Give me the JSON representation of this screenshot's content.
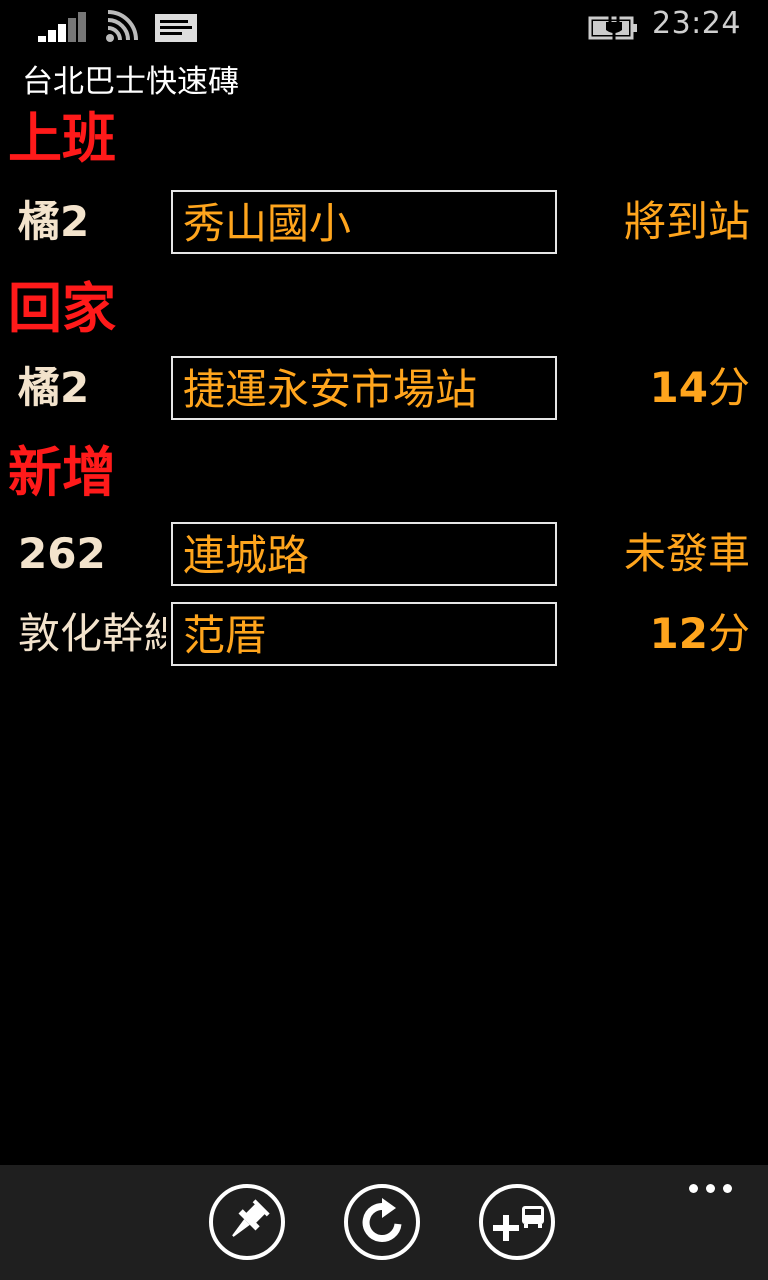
{
  "status_bar": {
    "time": "23:24",
    "icons": [
      "signal-icon",
      "wifi-icon",
      "message-icon",
      "battery-charging-icon"
    ]
  },
  "app": {
    "title": "台北巴士快速磚"
  },
  "sections": [
    {
      "heading": "上班",
      "rows": [
        {
          "route": "橘2",
          "stop": "秀山國小",
          "eta_num": "",
          "eta_text": "將到站"
        }
      ]
    },
    {
      "heading": "回家",
      "rows": [
        {
          "route": "橘2",
          "stop": "捷運永安市場站",
          "eta_num": "14",
          "eta_text": "分"
        }
      ]
    },
    {
      "heading": "新增",
      "rows": [
        {
          "route": "262",
          "stop": "連城路",
          "eta_num": "",
          "eta_text": "未發車"
        },
        {
          "route": "敦化幹線",
          "stop": "范厝",
          "eta_num": "12",
          "eta_text": "分"
        }
      ]
    }
  ],
  "appbar": {
    "buttons": [
      "pin-icon",
      "refresh-icon",
      "add-bus-icon"
    ],
    "more_icon": "more-dots-icon"
  },
  "colors": {
    "background": "#000000",
    "heading": "#ff1a1a",
    "accent": "#ffa51d",
    "route_text": "#f3e3cc",
    "appbar": "#1f1f1f"
  }
}
